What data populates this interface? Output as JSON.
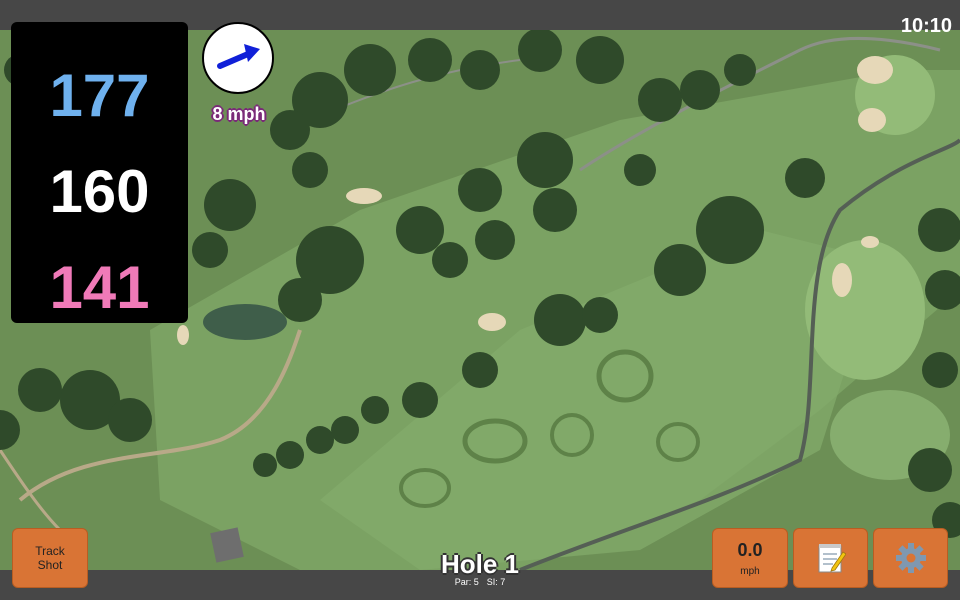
{
  "status_bar": {
    "time": "10:10"
  },
  "distances": {
    "back": "177",
    "middle": "160",
    "front": "141"
  },
  "wind": {
    "speed_label": "8 mph",
    "icon": "arrow-right-up-icon"
  },
  "hole": {
    "title": "Hole 1",
    "par_label": "Par: 5",
    "si_label": "SI: 7"
  },
  "buttons": {
    "track_shot": "Track\nShot",
    "speed_value": "0.0",
    "speed_unit": "mph",
    "notes_icon": "notepad-icon",
    "settings_icon": "gear-icon"
  },
  "colors": {
    "back": "#6fb1ee",
    "middle": "#ffffff",
    "front": "#f07ab8",
    "button": "#d97435",
    "wind_arrow": "#1020d8"
  }
}
